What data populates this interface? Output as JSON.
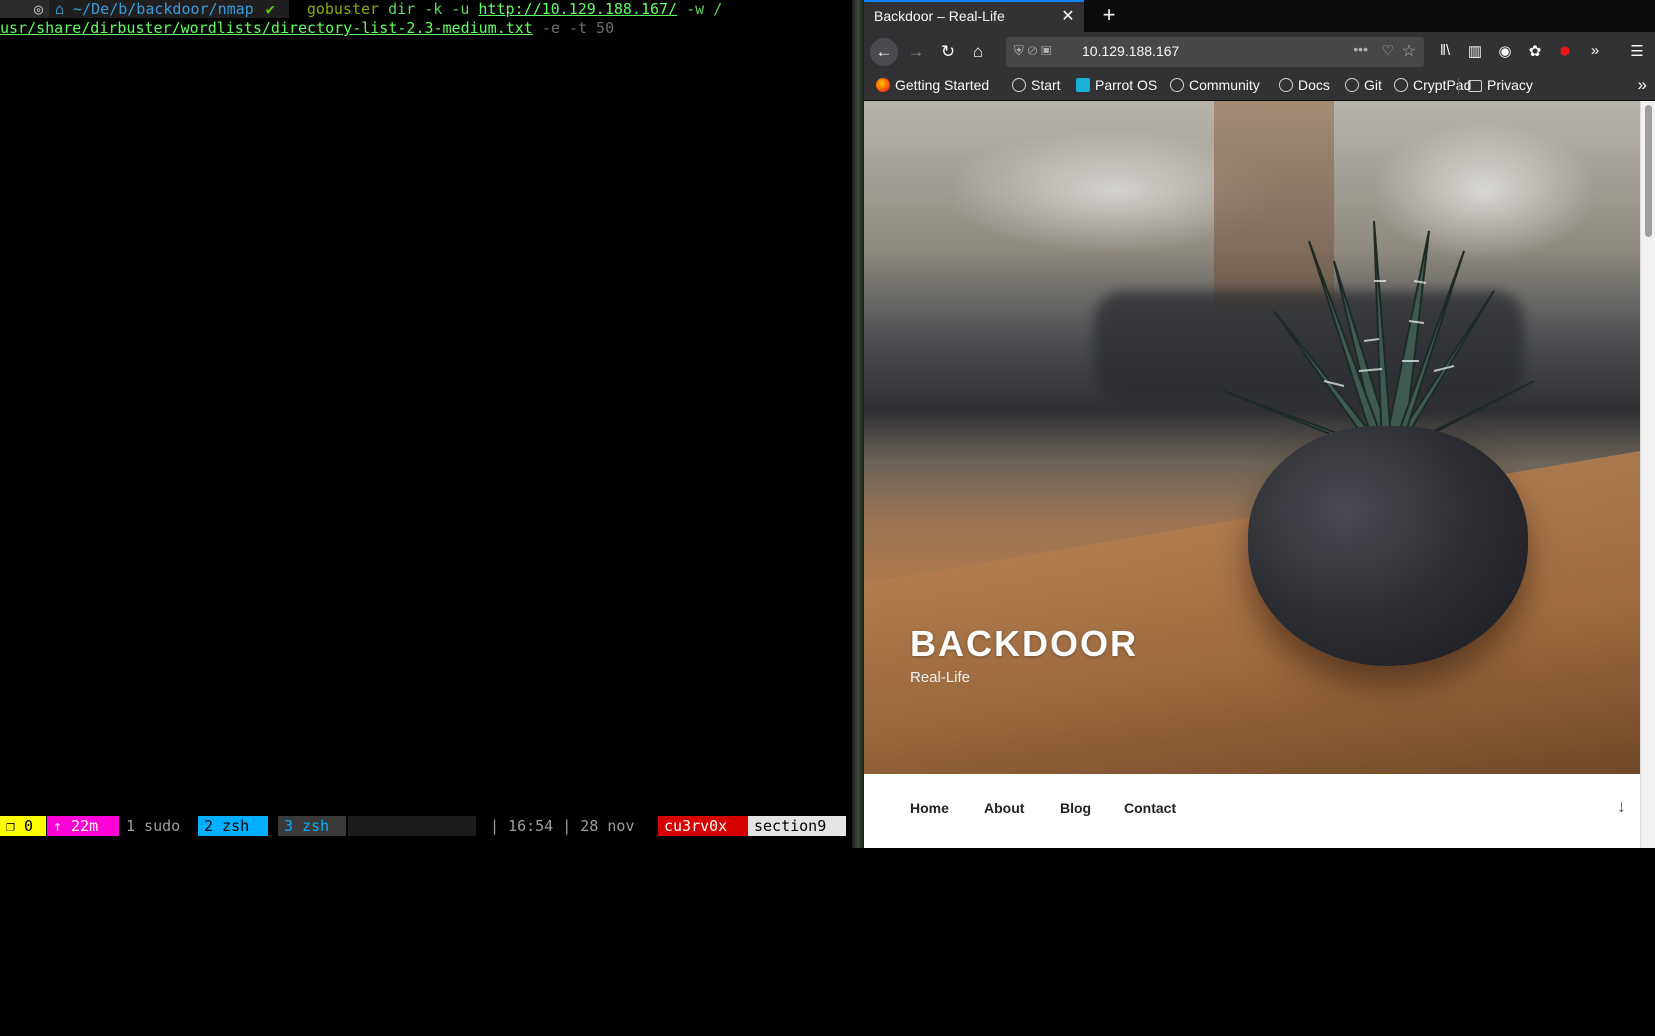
{
  "terminal": {
    "prompt": {
      "os_icon": "◎",
      "path_icon": "⌂",
      "path": "~/De/b/backdoor/nmap",
      "status_icon": "✔"
    },
    "command": {
      "program": "gobuster",
      "args": " dir -k -u ",
      "url": "http://10.129.188.167/",
      "flag_w": " -w /",
      "wordlist": "usr/share/dirbuster/wordlists/directory-list-2.3-medium.txt",
      "suggestion": " -e -t 50"
    },
    "tmux": {
      "pane": "❐ 0",
      "uptime": "↑ 22m",
      "window1": "1 sudo",
      "window2": "2 zsh",
      "window3": "3 zsh",
      "clock": "| 16:54 | 28 nov",
      "user": "cu3rv0x",
      "host": "section9"
    }
  },
  "browser": {
    "tab_title": "Backdoor – Real-Life",
    "url": "10.129.188.167",
    "bookmarks": [
      "Getting Started",
      "Start",
      "Parrot OS",
      "Community",
      "Docs",
      "Git",
      "CryptPad",
      "Privacy"
    ],
    "page": {
      "site_title": "BACKDOOR",
      "tagline": "Real-Life",
      "nav": [
        "Home",
        "About",
        "Blog",
        "Contact"
      ]
    }
  },
  "colors": {
    "accent": "#0a84ff",
    "terminal_green": "#5fd75f",
    "tmux_user": "#d70000"
  },
  "icons": {
    "back": "arrow-left-icon",
    "forward": "arrow-right-icon",
    "reload": "reload-icon",
    "home": "home-icon",
    "star": "star-icon",
    "menu": "hamburger-icon"
  }
}
